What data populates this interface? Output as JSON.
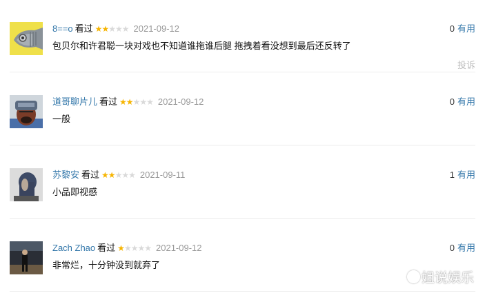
{
  "comments": [
    {
      "user": "8==o",
      "status": "看过",
      "rating": 2,
      "date": "2021-09-12",
      "votes": "0",
      "vote_label": "有用",
      "text": "包贝尔和许君聪一块对戏也不知道谁拖谁后腿 拖拽着看没想到最后还反转了",
      "report": "投诉"
    },
    {
      "user": "道哥聊片儿",
      "status": "看过",
      "rating": 2,
      "date": "2021-09-12",
      "votes": "0",
      "vote_label": "有用",
      "text": "一般"
    },
    {
      "user": "苏黎安",
      "status": "看过",
      "rating": 2,
      "date": "2021-09-11",
      "votes": "1",
      "vote_label": "有用",
      "text": "小品即视感"
    },
    {
      "user": "Zach Zhao",
      "status": "看过",
      "rating": 1,
      "date": "2021-09-12",
      "votes": "0",
      "vote_label": "有用",
      "text": "非常烂，十分钟没到就弃了"
    }
  ],
  "watermark": "姐说娱乐",
  "colors": {
    "link": "#3377aa",
    "star_on": "#f6b400",
    "star_off": "#d9d9d9",
    "muted": "#999999"
  }
}
